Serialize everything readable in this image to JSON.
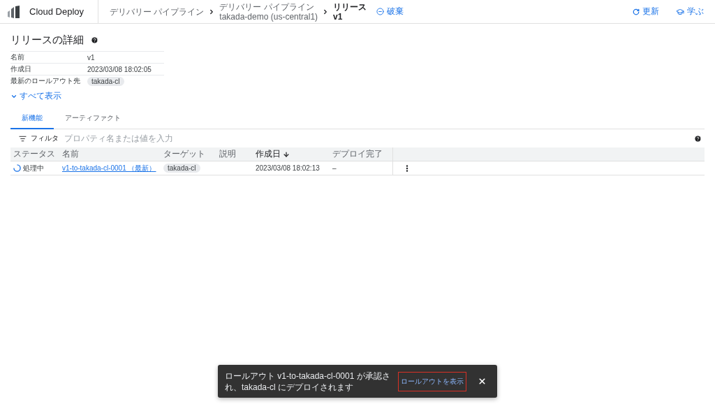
{
  "header": {
    "product": "Cloud Deploy",
    "breadcrumbs": [
      {
        "lines": [
          "デリバリー パイプライン"
        ]
      },
      {
        "lines": [
          "デリバリー パイプライン",
          "takada-demo (us-central1)"
        ]
      },
      {
        "lines": [
          "リリース",
          "v1"
        ]
      }
    ],
    "action": "破棄",
    "right_actions": [
      {
        "kind": "refresh",
        "label": "更新"
      },
      {
        "kind": "learn",
        "label": "学ぶ"
      }
    ]
  },
  "details": {
    "title": "リリースの詳細",
    "rows": [
      {
        "label": "名前",
        "value": "v1",
        "kind": "text"
      },
      {
        "label": "作成日",
        "value": "2023/03/08 18:02:05",
        "kind": "text"
      },
      {
        "label": "最新のロールアウト先",
        "value": "takada-cl",
        "kind": "chip"
      }
    ],
    "show_all": "すべて表示"
  },
  "tabs": [
    {
      "label": "新機能",
      "selected": true
    },
    {
      "label": "アーティファクト",
      "selected": false
    }
  ],
  "filter": {
    "label": "フィルタ",
    "placeholder": "プロパティ名または値を入力"
  },
  "table": {
    "columns": [
      {
        "label": "ステータス",
        "sorted": false
      },
      {
        "label": "名前",
        "sorted": false
      },
      {
        "label": "ターゲット",
        "sorted": false
      },
      {
        "label": "説明",
        "sorted": false
      },
      {
        "label": "作成日",
        "sorted": true
      },
      {
        "label": "デプロイ完了",
        "sorted": false
      }
    ],
    "rows": [
      {
        "status": {
          "kind": "processing",
          "label": "処理中"
        },
        "name": "v1-to-takada-cl-0001 （最新）",
        "target": "takada-cl",
        "description": "",
        "created": "2023/03/08 18:02:13",
        "deployed": "–"
      }
    ]
  },
  "snackbar": {
    "message": "ロールアウト v1-to-takada-cl-0001 が承認され、takada-cl にデプロイされます",
    "action": "ロールアウトを表示",
    "action_highlighted": true
  }
}
